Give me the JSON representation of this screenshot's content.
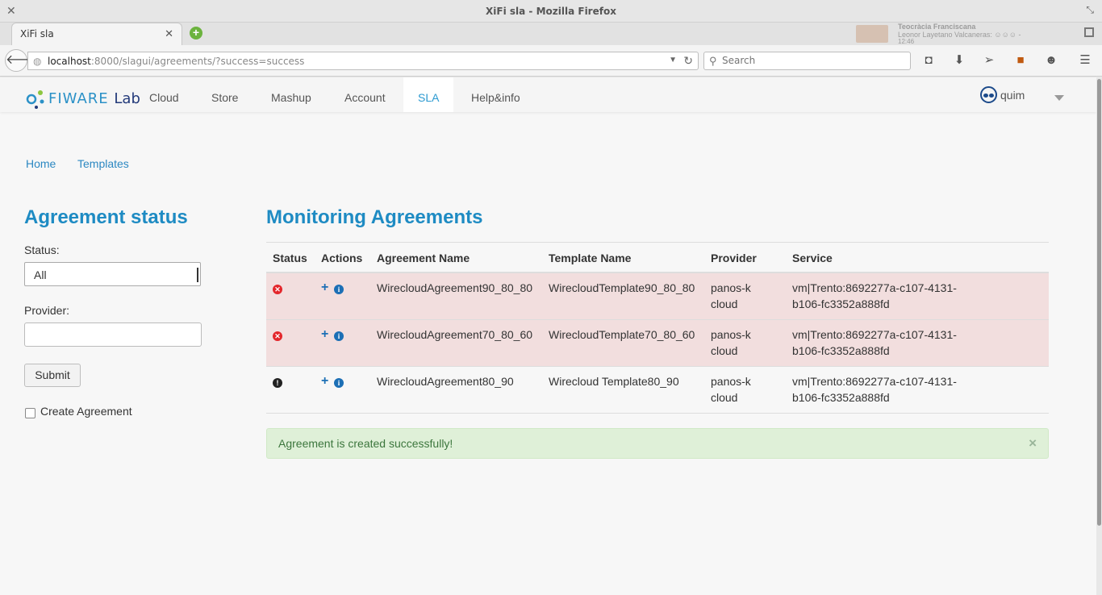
{
  "window": {
    "title": "XiFi sla - Mozilla Firefox"
  },
  "tab": {
    "title": "XiFi sla"
  },
  "notification": {
    "line1": "Teocràcia Franciscana",
    "line2": "Leonor Layetano Valcaneras: ☺☺☺ -",
    "line3": "12:46"
  },
  "address": {
    "host": "localhost",
    "path": ":8000/slagui/agreements/?success=success"
  },
  "search": {
    "placeholder": "Search"
  },
  "topnav": {
    "logo_fiware": "FIWARE",
    "logo_lab": "Lab",
    "items": [
      "Cloud",
      "Store",
      "Mashup",
      "Account",
      "SLA",
      "Help&info"
    ],
    "active": "SLA",
    "user": "quim"
  },
  "breadcrumb": {
    "home": "Home",
    "templates": "Templates"
  },
  "sidebar": {
    "title": "Agreement status",
    "status_label": "Status:",
    "status_value": "All",
    "provider_label": "Provider:",
    "submit_label": "Submit",
    "create_label": "Create Agreement"
  },
  "main": {
    "title": "Monitoring Agreements",
    "columns": [
      "Status",
      "Actions",
      "Agreement Name",
      "Template Name",
      "Provider",
      "Service"
    ],
    "rows": [
      {
        "status": "error",
        "agreement": "WirecloudAgreement90_80_80",
        "template": "WirecloudTemplate90_80_80",
        "provider_1": "panos-k",
        "provider_2": "cloud",
        "service_1": "vm|Trento:8692277a-c107-4131-",
        "service_2": "b106-fc3352a888fd"
      },
      {
        "status": "error",
        "agreement": "WirecloudAgreement70_80_60",
        "template": "WirecloudTemplate70_80_60",
        "provider_1": "panos-k",
        "provider_2": "cloud",
        "service_1": "vm|Trento:8692277a-c107-4131-",
        "service_2": "b106-fc3352a888fd"
      },
      {
        "status": "warning",
        "agreement": "WirecloudAgreement80_90",
        "template": "Wirecloud Template80_90",
        "provider_1": "panos-k",
        "provider_2": "cloud",
        "service_1": "vm|Trento:8692277a-c107-4131-",
        "service_2": "b106-fc3352a888fd"
      }
    ]
  },
  "alert": {
    "message": "Agreement is created successfully!",
    "close": "×"
  },
  "colors": {
    "accent": "#1e8bc3",
    "danger_row": "#f2dede",
    "success_bg": "#dff0d8",
    "success_text": "#3c763d"
  }
}
